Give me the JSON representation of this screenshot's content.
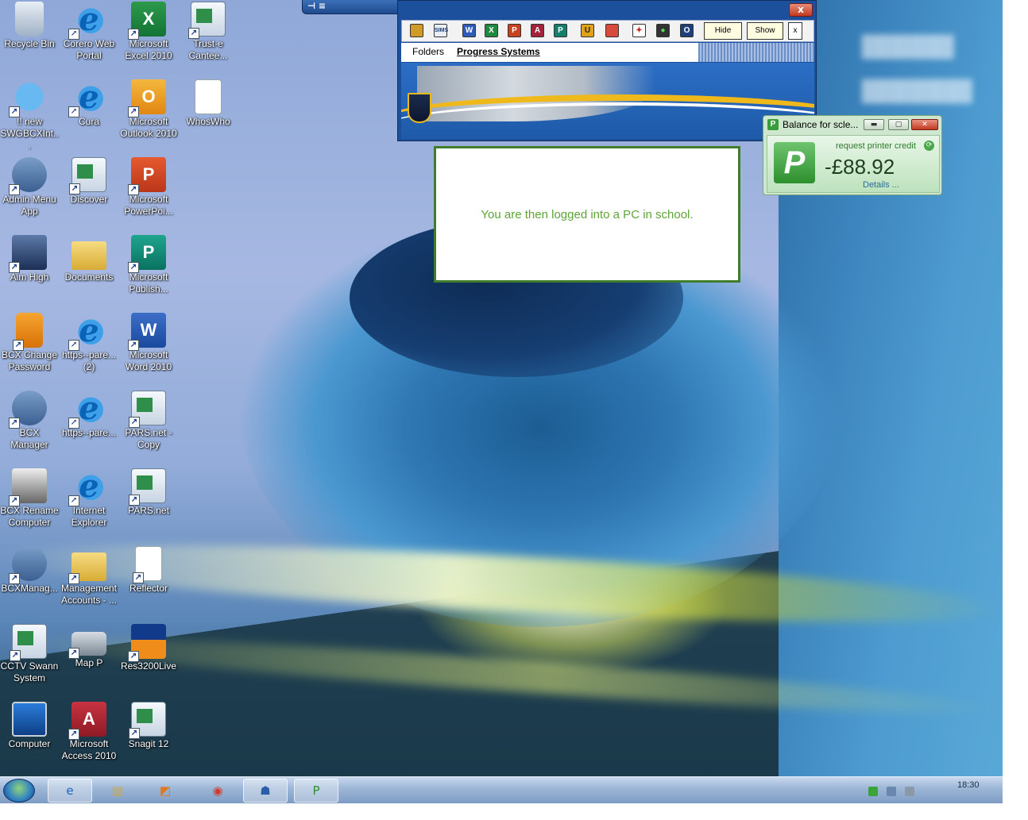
{
  "desktop_icons": [
    {
      "label": "Recycle Bin",
      "icon": "recycle-bin-icon"
    },
    {
      "label": "Corero Web Portal",
      "icon": "internet-explorer-icon"
    },
    {
      "label": "Microsoft Excel 2010",
      "icon": "excel-icon"
    },
    {
      "label": "Trust-e Cantee...",
      "icon": "application-icon"
    },
    {
      "label": "!! new SWGBCXInt...",
      "icon": "globe-icon"
    },
    {
      "label": "Cura",
      "icon": "internet-explorer-icon"
    },
    {
      "label": "Microsoft Outlook 2010",
      "icon": "outlook-icon"
    },
    {
      "label": "WhosWho",
      "icon": "document-icon"
    },
    {
      "label": "Admin Menu App",
      "icon": "users-icon"
    },
    {
      "label": "Discover",
      "icon": "application-icon"
    },
    {
      "label": "Microsoft PowerPoi...",
      "icon": "powerpoint-icon"
    },
    {
      "label": "Aim High",
      "icon": "network-icon"
    },
    {
      "label": "Documents",
      "icon": "folder-icon"
    },
    {
      "label": "Microsoft Publish...",
      "icon": "publisher-icon"
    },
    {
      "label": "BCX Change Password",
      "icon": "lock-icon"
    },
    {
      "label": "https--pare... (2)",
      "icon": "internet-explorer-icon"
    },
    {
      "label": "Microsoft Word 2010",
      "icon": "word-icon"
    },
    {
      "label": "BCX Manager",
      "icon": "users-icon"
    },
    {
      "label": "https--pare...",
      "icon": "internet-explorer-icon"
    },
    {
      "label": "PARS.net - Copy",
      "icon": "application-icon"
    },
    {
      "label": "BCX Rename Computer",
      "icon": "rename-icon"
    },
    {
      "label": "Internet Explorer",
      "icon": "internet-explorer-icon"
    },
    {
      "label": "PARS.net",
      "icon": "application-icon"
    },
    {
      "label": "BCXManag...",
      "icon": "users-icon"
    },
    {
      "label": "Management Accounts - ...",
      "icon": "folder-icon"
    },
    {
      "label": "Reflector",
      "icon": "document-icon"
    },
    {
      "label": "CCTV Swann System",
      "icon": "application-icon"
    },
    {
      "label": "Map P",
      "icon": "network-drive-icon"
    },
    {
      "label": "Res3200Live",
      "icon": "res-icon"
    },
    {
      "label": "Computer",
      "icon": "computer-icon"
    },
    {
      "label": "Microsoft Access 2010",
      "icon": "access-icon"
    },
    {
      "label": "Snagit 12",
      "icon": "application-icon"
    }
  ],
  "launcher": {
    "close_label": "x",
    "tools": [
      "W",
      "X",
      "P",
      "A",
      "P",
      "U",
      "O"
    ],
    "hide_label": "Hide",
    "show_label": "Show",
    "small_close_label": "x",
    "menu": [
      {
        "label": "Folders"
      },
      {
        "label": "Progress Systems"
      }
    ]
  },
  "message": {
    "text": "You are then logged into a PC in school."
  },
  "balance": {
    "title": "Balance for scle...",
    "request_label": "request printer credit",
    "amount": "-£88.92",
    "details_label": "Details ..."
  },
  "taskbar": {
    "clock": "18:30"
  }
}
